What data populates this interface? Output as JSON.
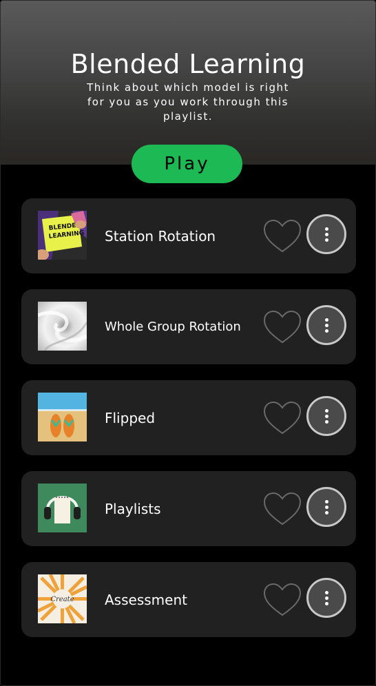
{
  "playlist": {
    "title": "Blended Learning",
    "description": "Think about which model is right for you as you work through this playlist.",
    "play_label": "Play",
    "accent_color": "#1db954"
  },
  "tracks": [
    {
      "title": "Station Rotation",
      "thumbnail": "blended-learning-sign-image",
      "thumb_text": [
        "BLENDED",
        "LEARNING"
      ]
    },
    {
      "title": "Whole Group Rotation",
      "thumbnail": "white-swirl-image"
    },
    {
      "title": "Flipped",
      "thumbnail": "flip-flops-pool-image"
    },
    {
      "title": "Playlists",
      "thumbnail": "headphones-notepad-image"
    },
    {
      "title": "Assessment",
      "thumbnail": "create-sunburst-image",
      "thumb_text": [
        "Create"
      ]
    }
  ],
  "icons": {
    "favorite": "heart-outline-icon",
    "more": "vertical-ellipsis-icon"
  }
}
